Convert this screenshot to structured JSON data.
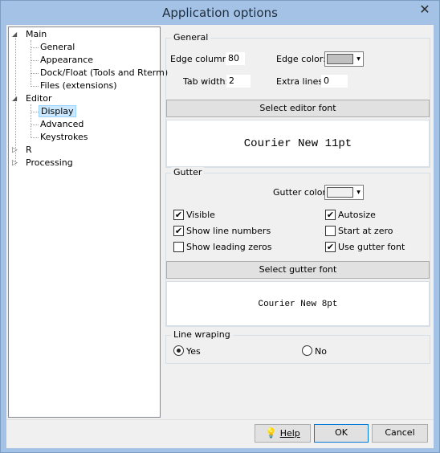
{
  "window": {
    "title": "Application options",
    "close_glyph": "✕"
  },
  "tree": {
    "main": "Main",
    "main_children": [
      "General",
      "Appearance",
      "Dock/Float (Tools and Rterm)",
      "Files (extensions)"
    ],
    "editor": "Editor",
    "editor_children": [
      "Display",
      "Advanced",
      "Keystrokes"
    ],
    "r": "R",
    "processing": "Processing",
    "selected": "Display"
  },
  "general": {
    "title": "General",
    "edge_column_label": "Edge column:",
    "edge_column_value": "80",
    "edge_color_label": "Edge color:",
    "edge_color": "#c0c0c0",
    "tab_width_label": "Tab width:",
    "tab_width_value": "2",
    "extra_lines_label": "Extra lines:",
    "extra_lines_value": "0",
    "select_font_button": "Select editor font",
    "font_preview": "Courier New 11pt"
  },
  "gutter": {
    "title": "Gutter",
    "gutter_color_label": "Gutter color:",
    "gutter_color": "#f0f0f0",
    "visible_label": "Visible",
    "visible_checked": true,
    "show_line_numbers_label": "Show line numbers",
    "show_line_numbers_checked": true,
    "show_leading_zeros_label": "Show leading zeros",
    "show_leading_zeros_checked": false,
    "autosize_label": "Autosize",
    "autosize_checked": true,
    "start_at_zero_label": "Start at zero",
    "start_at_zero_checked": false,
    "use_gutter_font_label": "Use gutter font",
    "use_gutter_font_checked": true,
    "select_font_button": "Select gutter font",
    "font_preview": "Courier New 8pt"
  },
  "line_wrapping": {
    "title": "Line wraping",
    "yes_label": "Yes",
    "no_label": "No",
    "selected": "Yes"
  },
  "footer": {
    "help_label": "Help",
    "ok_label": "OK",
    "cancel_label": "Cancel"
  }
}
